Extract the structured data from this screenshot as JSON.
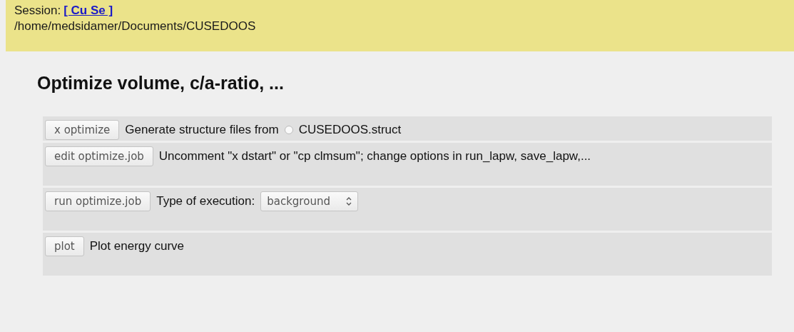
{
  "header": {
    "session_label": "Session:",
    "session_link": "[ Cu  Se ]",
    "path": "/home/medsidamer/Documents/CUSEDOOS"
  },
  "title": "Optimize volume, c/a-ratio, ...",
  "rows": [
    {
      "kind": "radio",
      "button": "x optimize",
      "text": "Generate structure files from",
      "option": {
        "label": "CUSEDOOS.struct",
        "selected": false
      }
    },
    {
      "kind": "text",
      "button": "edit optimize.job",
      "text": "Uncomment \"x dstart\" or \"cp clmsum\"; change options in run_lapw, save_lapw,..."
    },
    {
      "kind": "select",
      "button": "run optimize.job",
      "text": "Type of execution:",
      "value": "background"
    },
    {
      "kind": "text",
      "button": "plot",
      "text": "Plot energy curve"
    }
  ]
}
